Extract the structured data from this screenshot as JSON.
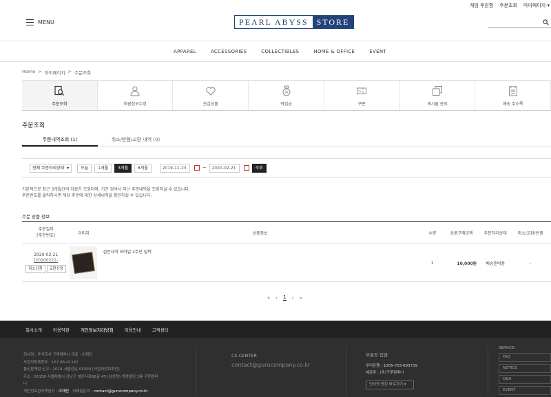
{
  "top_links": [
    "게임 후원함",
    "주문조회",
    "마이페이지 ▾"
  ],
  "header": {
    "menu_label": "MENU",
    "logo_left": "PEARL ABYSS",
    "logo_right": "STORE"
  },
  "nav": [
    "APPAREL",
    "ACCESSORIES",
    "COLLECTIBLES",
    "HOME & OFFICE",
    "EVENT"
  ],
  "breadcrumb": [
    "Home",
    ">",
    "마이페이지",
    ">",
    "주문조회"
  ],
  "mymenu": [
    "주문조회",
    "회원정보수정",
    "관심상품",
    "적립금",
    "쿠폰",
    "게시물 관리",
    "배송 주소록"
  ],
  "section_title": "주문조회",
  "tabs": [
    "주문내역조회 (1)",
    "취소/반품/교환 내역 (0)"
  ],
  "filter": {
    "status": "전체 주문처리상태",
    "periods": [
      "오늘",
      "1개월",
      "3개월",
      "6개월"
    ],
    "active_period": "3개월",
    "date_from": "2019-11-23",
    "tilde": "~",
    "date_to": "2020-02-21",
    "search": "조회"
  },
  "notice": [
    "기본적으로 최근 3개월간의 자료가 조회되며, 기간 검색시 지난 주문내역을 조회하실 수 있습니다.",
    "주문번호를 클릭하시면 해당 주문에 대한 상세내역을 확인하실 수 있습니다."
  ],
  "product_title": "주문 상품 정보",
  "columns": [
    "주문일자\n[주문번호]",
    "이미지",
    "상품정보",
    "수량",
    "상품구매금액",
    "주문처리상태",
    "취소/교환/반품"
  ],
  "order": {
    "date": "2020-02-21",
    "number": "[20200221-",
    "btn_cancel": "취소신청",
    "btn_exchange": "교환신청",
    "product": "검은사막 모바일 2주년 달력",
    "qty": "1",
    "price": "10,000원",
    "status": "배송준비중",
    "cancel": "-"
  },
  "pager": {
    "first": "«",
    "prev": "‹",
    "current": "1",
    "next": "›",
    "last": "»"
  },
  "footer": {
    "links": [
      "회사소개",
      "이용약관",
      "개인정보처리방침",
      "이용안내",
      "고객센터"
    ],
    "info": [
      "회사명 : 주식회사 구루컴퍼니    대표 : 이재진",
      "사업자등록번호 : 167-86-01247",
      "통신판매업 신고 : 2019-서울강남-05300 [사업자정보확인]",
      "주소 : 06156 서울특별시 강남구 봉은사로68길 45 (삼성동) 영경빌딩 2층 구루컴퍼",
      "니"
    ],
    "privacy_label": "개인정보관리책임자 : ",
    "privacy_name": "이재진",
    "inquiry_label": "이메일문의 : ",
    "inquiry_mail": "contact@gurucompany.co.kr",
    "cs_title": "CS CENTER",
    "cs_mail": "contact@gurucompany.co.kr",
    "bank_title": "무통장 입금",
    "bank_line": "우리은행 : 1005-703-693739",
    "bank_holder": "예금주 : (주)구루컴퍼니",
    "bank_select": "인터넷 뱅킹 바로가기 ▾",
    "service_title": "SERVICE",
    "service": [
      "FAQ",
      "NOTICE",
      "Q&A",
      "EVENT"
    ]
  }
}
